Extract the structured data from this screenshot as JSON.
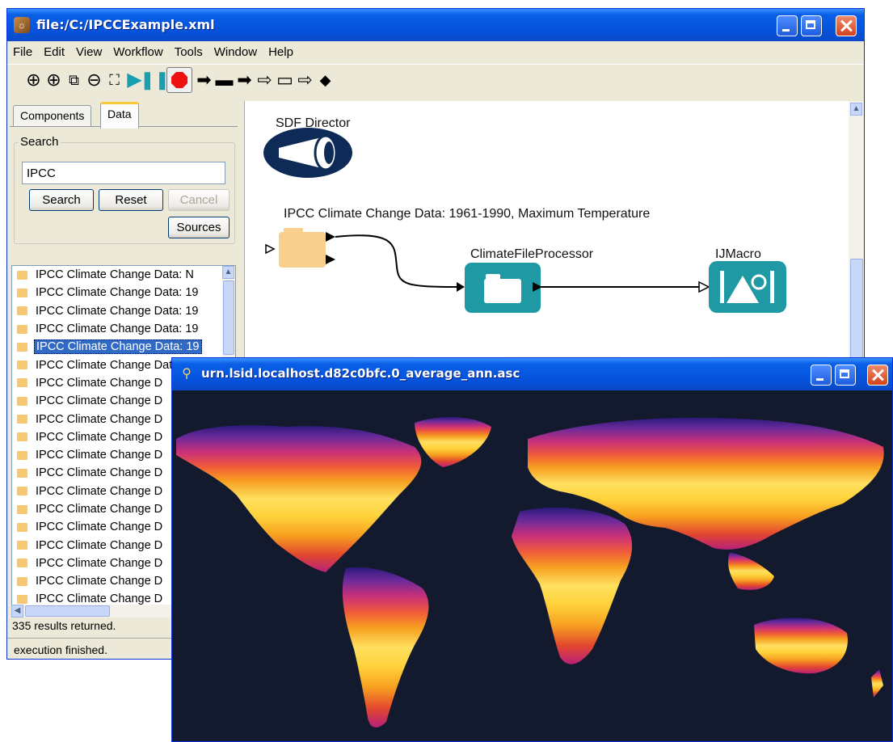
{
  "main_window": {
    "title": "file:/C:/IPCCExample.xml",
    "menus": [
      "File",
      "Edit",
      "View",
      "Workflow",
      "Tools",
      "Window",
      "Help"
    ]
  },
  "toolbar": {
    "icons": [
      "zoom-in-icon",
      "zoom-reset-icon",
      "zoom-fit-icon",
      "zoom-out-icon",
      "full-screen-icon",
      "run-icon",
      "pause-icon",
      "stop-icon",
      "arrow-right-icon",
      "flag-icon",
      "arrow-bold-icon",
      "arrow-outline-icon",
      "flag-outline-icon",
      "arrow-outline-2-icon",
      "diamond-icon"
    ]
  },
  "left_panel": {
    "tabs": [
      "Components",
      "Data"
    ],
    "active_tab": "Data",
    "search_label": "Search",
    "search_value": "IPCC",
    "search_button": "Search",
    "reset_button": "Reset",
    "cancel_button": "Cancel",
    "sources_button": "Sources",
    "results": [
      "IPCC Climate Change Data:  N",
      "IPCC Climate Change Data: 19",
      "IPCC Climate Change Data: 19",
      "IPCC Climate Change Data: 19",
      "IPCC Climate Change Data: 19",
      "IPCC Climate Change Data: 19",
      "IPCC Climate Change D",
      "IPCC Climate Change D",
      "IPCC Climate Change D",
      "IPCC Climate Change D",
      "IPCC Climate Change D",
      "IPCC Climate Change D",
      "IPCC Climate Change D",
      "IPCC Climate Change D",
      "IPCC Climate Change D",
      "IPCC Climate Change D",
      "IPCC Climate Change D",
      "IPCC Climate Change D",
      "IPCC Climate Change D",
      "IPCC Climate Change"
    ],
    "selected_index": 4,
    "results_count": "335 results returned."
  },
  "status": "execution finished.",
  "workflow": {
    "director": "SDF Director",
    "data_label": "IPCC Climate Change Data: 1961-1990, Maximum Temperature",
    "processor": "ClimateFileProcessor",
    "macro": "IJMacro"
  },
  "image_window": {
    "title": "urn.lsid.localhost.d82c0bfc.0_average_ann.asc"
  },
  "colors": {
    "titlebar": "#0655df",
    "actor": "#1f9aa5",
    "map_background": "#141a2e"
  }
}
